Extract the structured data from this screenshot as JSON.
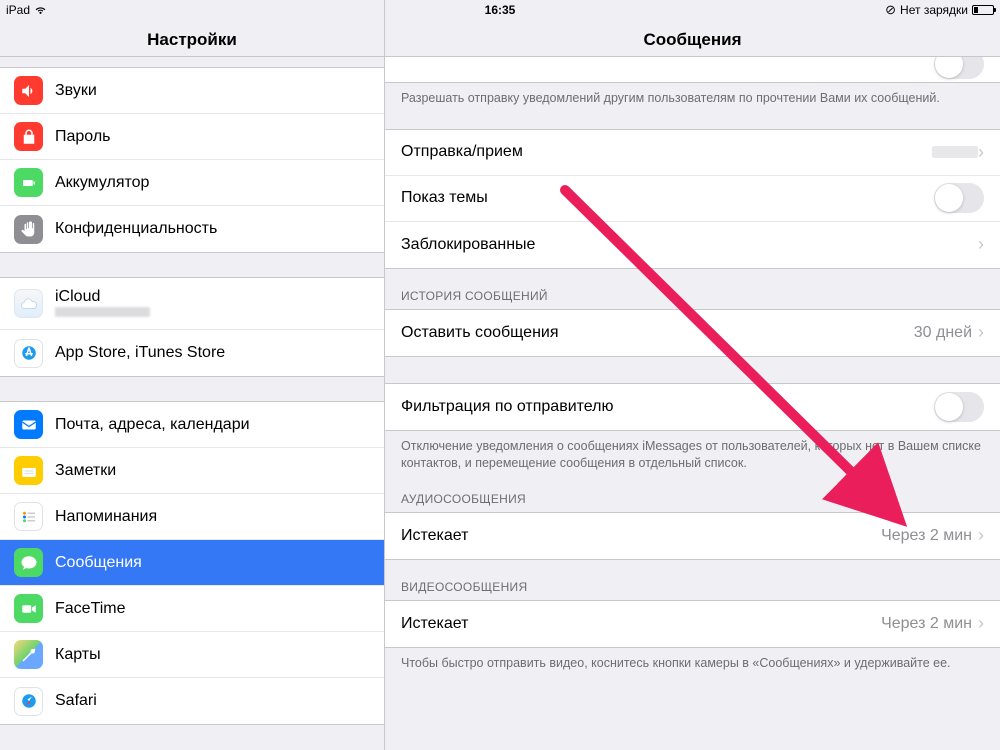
{
  "statusbar": {
    "device": "iPad",
    "time": "16:35",
    "charging": "Нет зарядки"
  },
  "sidebar": {
    "title": "Настройки",
    "g1": [
      {
        "id": "sounds",
        "label": "Звуки"
      },
      {
        "id": "passcode",
        "label": "Пароль"
      },
      {
        "id": "battery",
        "label": "Аккумулятор"
      },
      {
        "id": "privacy",
        "label": "Конфиденциальность"
      }
    ],
    "g2": [
      {
        "id": "icloud",
        "label": "iCloud"
      },
      {
        "id": "appstore",
        "label": "App Store, iTunes Store"
      }
    ],
    "g3": [
      {
        "id": "mail",
        "label": "Почта, адреса, календари"
      },
      {
        "id": "notes",
        "label": "Заметки"
      },
      {
        "id": "reminders",
        "label": "Напоминания"
      },
      {
        "id": "messages",
        "label": "Сообщения"
      },
      {
        "id": "facetime",
        "label": "FaceTime"
      },
      {
        "id": "maps",
        "label": "Карты"
      },
      {
        "id": "safari",
        "label": "Safari"
      }
    ]
  },
  "detail": {
    "title": "Сообщения",
    "readReceipts": {
      "footer": "Разрешать отправку уведомлений другим пользователям по прочтении Вами их сообщений."
    },
    "mainGroup": {
      "sendReceive": "Отправка/прием",
      "showSubject": "Показ темы",
      "blocked": "Заблокированные"
    },
    "history": {
      "header": "ИСТОРИЯ СООБЩЕНИЙ",
      "keep": "Оставить сообщения",
      "keepValue": "30 дней"
    },
    "filter": {
      "label": "Фильтрация по отправителю",
      "footer": "Отключение уведомления о сообщениях iMessages от пользователей, которых нет в Вашем списке контактов, и перемещение сообщения  в отдельный список."
    },
    "audio": {
      "header": "АУДИОСООБЩЕНИЯ",
      "expire": "Истекает",
      "expireValue": "Через 2 мин"
    },
    "video": {
      "header": "ВИДЕОСООБЩЕНИЯ",
      "expire": "Истекает",
      "expireValue": "Через 2 мин",
      "footer": "Чтобы быстро отправить видео, коснитесь кнопки камеры в «Сообщениях» и удерживайте ее."
    }
  }
}
